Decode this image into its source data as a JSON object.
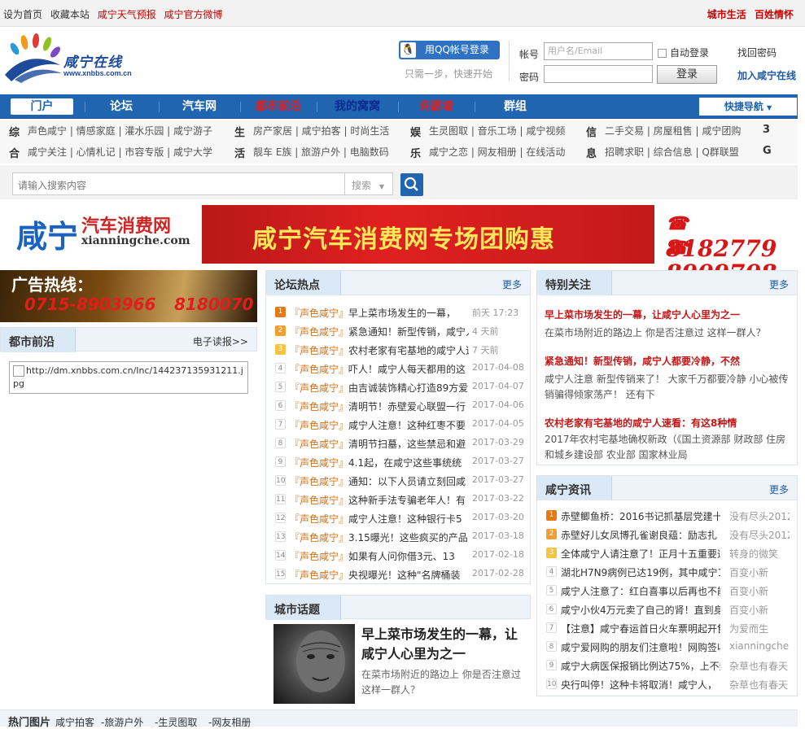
{
  "topbar": {
    "links": [
      "设为首页",
      "收藏本站",
      "咸宁天气预报",
      "咸宁官方微博"
    ],
    "right": [
      "城市生活",
      "百姓情怀"
    ]
  },
  "logo": {
    "name": "咸宁在线",
    "url": "www.xnbbs.com.cn"
  },
  "login": {
    "qq_button": "用QQ帐号登录",
    "qq_tip": "只需一步，快速开始",
    "account_label": "帐号",
    "account_placeholder": "用户名/Email",
    "password_label": "密码",
    "auto_login": "自动登录",
    "login_button": "登录",
    "find_password": "找回密码",
    "join": "加入咸宁在线"
  },
  "nav": {
    "items": [
      "门户",
      "论坛",
      "汽车网",
      "都市前沿",
      "我的窝窝",
      "许愿墙",
      "群组"
    ],
    "quick": "快捷导航"
  },
  "linkgroups": {
    "row1": {
      "c1": "综",
      "l1": "声色咸宁 | 情感家庭 | 灌水乐园 | 咸宁游子",
      "c2": "生",
      "l2": "房产家居 | 咸宁拍客 | 时尚生活",
      "c3": "娱",
      "l3": "生灵图取 | 音乐工场 | 咸宁视频",
      "c4": "信",
      "l4": "二手交易 | 房屋租售 | 咸宁团购",
      "c5": "3"
    },
    "row2": {
      "c1": "合",
      "l1": "咸宁关注 | 心情札记 | 市容专版 | 咸宁大学",
      "c2": "活",
      "l2": "靓车 E族 | 旅游户外 | 电脑数码",
      "c3": "乐",
      "l3": "咸宁之恋 | 网友相册 | 在线活动",
      "c4": "息",
      "l4": "招聘求职 | 综合信息 | Q群联盟",
      "c5": "G"
    }
  },
  "search": {
    "placeholder": "请输入搜索内容",
    "select": "搜索"
  },
  "banner": {
    "brand": "咸宁",
    "brand_sub": "汽车消费网",
    "domain": "xianningche.com",
    "slogan": "咸宁汽车消费网专场团购惠",
    "phone1": "8182779",
    "phone2": "8909708"
  },
  "ad": {
    "label": "广告热线：",
    "phone1": "0715-8903966",
    "phone2": "8180070"
  },
  "dushi": {
    "title": "都市前沿",
    "more": "电子读报>>",
    "img_alt": "http://dm.xnbbs.com.cn/Inc/144237135931211.jpg"
  },
  "forum": {
    "title": "论坛热点",
    "more": "更多",
    "tag": "『声色咸宁』",
    "rows": [
      {
        "n": "1",
        "title": "早上菜市场发生的一幕，",
        "date": "前天  17:23"
      },
      {
        "n": "2",
        "title": "紧急通知！新型传销，咸宁人",
        "date": "4  天前"
      },
      {
        "n": "3",
        "title": "农村老家有宅基地的咸宁人速",
        "date": "7  天前"
      },
      {
        "n": "4",
        "title": "吓人！咸宁人每天都用的这",
        "date": "2017-04-08"
      },
      {
        "n": "5",
        "title": "由吉诚装饰精心打造89方爱",
        "date": "2017-04-07"
      },
      {
        "n": "6",
        "title": "清明节！赤壁爱心联盟一行",
        "date": "2017-04-06"
      },
      {
        "n": "7",
        "title": "咸宁人注意！这种红枣不要",
        "date": "2017-04-05"
      },
      {
        "n": "8",
        "title": "清明节扫墓，这些禁忌和避",
        "date": "2017-03-29"
      },
      {
        "n": "9",
        "title": "4.1起，在咸宁这些事统统",
        "date": "2017-03-27"
      },
      {
        "n": "10",
        "title": "通知：以下人员请立刻回咸",
        "date": "2017-03-27"
      },
      {
        "n": "11",
        "title": "这种新手法专骗老年人！有",
        "date": "2017-03-22"
      },
      {
        "n": "12",
        "title": "咸宁人注意！这种银行卡5",
        "date": "2017-03-20"
      },
      {
        "n": "13",
        "title": "3.15曝光！这些疯买的产品",
        "date": "2017-03-18"
      },
      {
        "n": "14",
        "title": "如果有人问你借3元、13",
        "date": "2017-02-18"
      },
      {
        "n": "15",
        "title": "央视曝光！这种\"名牌桶装",
        "date": "2017-02-28"
      }
    ]
  },
  "citytopic": {
    "title": "城市话题",
    "headline": "早上菜市场发生的一幕，让咸宁人心里为之一",
    "desc": "在菜市场附近的路边上 你是否注意过这样一群人？"
  },
  "special": {
    "title": "特别关注",
    "more": "更多",
    "items": [
      {
        "h": "早上菜市场发生的一幕，让咸宁人心里为之一",
        "d": "在菜市场附近的路边上 你是否注意过 这样一群人？"
      },
      {
        "h": "紧急通知！新型传销，咸宁人都要冷静，不然",
        "d": "咸宁人注意 新型传销来了！ 大家千万都要冷静 小心被传销骗得倾家荡产！ 还有下"
      },
      {
        "h": "农村老家有宅基地的咸宁人速看：有这8种情",
        "d": "2017年农村宅基地确权新政（《国土资源部 财政部 住房和城乡建设部 农业部 国家林业局"
      }
    ]
  },
  "news": {
    "title": "咸宁资讯",
    "more": "更多",
    "rows": [
      {
        "n": "1",
        "title": "赤壁鲫鱼桥：2016书记抓基层党建十",
        "author": "没有尽头2012"
      },
      {
        "n": "2",
        "title": "赤壁好儿女凤博孔雀谢良蕴：励志扎",
        "author": "没有尽头2012"
      },
      {
        "n": "3",
        "title": "全体咸宁人请注意了！正月十五重要通",
        "author": "转身的微笑"
      },
      {
        "n": "4",
        "title": "湖北H7N9病例已达19例，其中咸宁1例！禽",
        "author": "百变小新"
      },
      {
        "n": "5",
        "title": "咸宁人注意了：红白喜事以后再也不能大",
        "author": "百变小新"
      },
      {
        "n": "6",
        "title": "咸宁小伙4万元卖了自己的肾！直到身体出",
        "author": "百变小新"
      },
      {
        "n": "7",
        "title": "【注意】咸宁春运首日火车票明起开售",
        "author": "为爱而生"
      },
      {
        "n": "8",
        "title": "咸宁爱网购的朋友们注意啦！网购签收",
        "author": "xianningche"
      },
      {
        "n": "9",
        "title": "咸宁大病医保报销比例达75%，上不封",
        "author": "杂草也有春天"
      },
      {
        "n": "10",
        "title": "央行叫停！这种卡将取消！咸宁人，",
        "author": "杂草也有春天"
      }
    ]
  },
  "bottom": {
    "title": "热门图片",
    "links": [
      "咸宁拍客",
      "-旅游户外",
      "-生灵图取",
      "-网友相册"
    ]
  }
}
